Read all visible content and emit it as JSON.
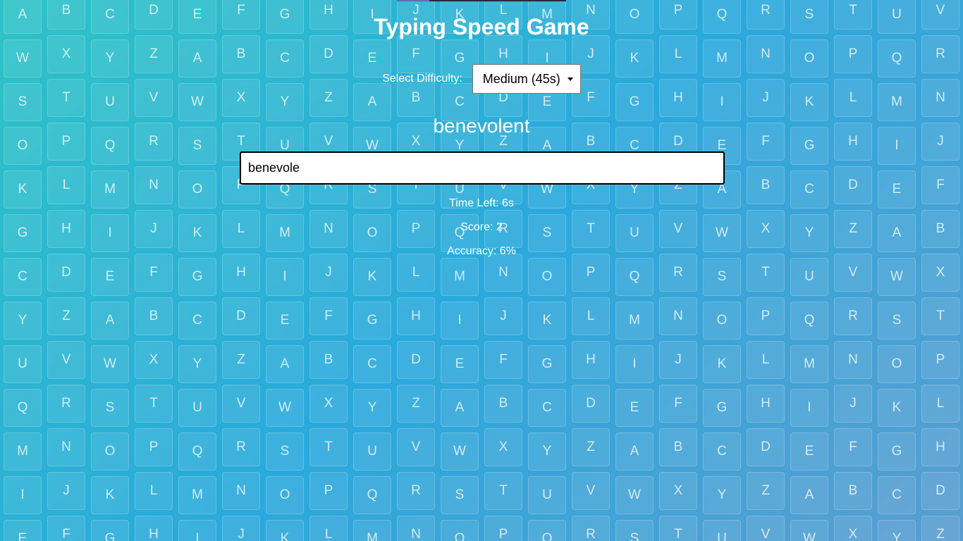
{
  "game": {
    "title": "Typing Speed Game",
    "difficulty_label": "Select Difficulty:",
    "difficulty_selected": "Medium (45s)",
    "target_word": "benevolent",
    "input_value": "benevole",
    "time_left": "Time Left: 6s",
    "score": "Score: 2",
    "accuracy": "Accuracy: 6%"
  },
  "background": {
    "alphabet": "ABCDEFGHIJKLMNOPQRSTUVWXYZ",
    "columns": 22,
    "rows": 13
  },
  "colors": {
    "gradient_start": "#2ec3c6",
    "gradient_end": "#5a9dd0",
    "text": "#ffffff"
  }
}
